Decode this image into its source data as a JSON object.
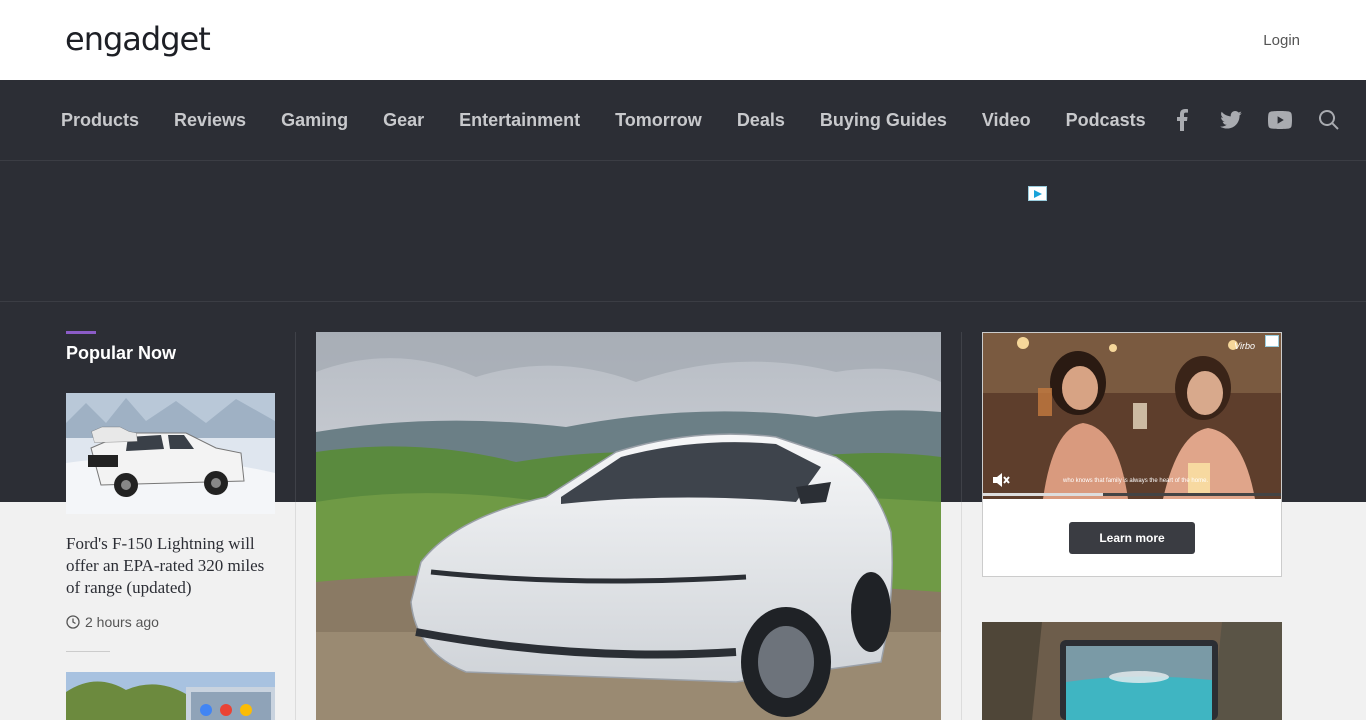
{
  "header": {
    "logo_text": "engadget",
    "login_label": "Login"
  },
  "nav": {
    "items": [
      "Products",
      "Reviews",
      "Gaming",
      "Gear",
      "Entertainment",
      "Tomorrow",
      "Deals",
      "Buying Guides",
      "Video",
      "Podcasts"
    ],
    "icons": [
      "facebook-icon",
      "twitter-icon",
      "youtube-icon",
      "search-icon"
    ]
  },
  "popular": {
    "title": "Popular Now",
    "items": [
      {
        "headline": "Ford's F-150 Lightning will offer an EPA-rated 320 miles of range (updated)",
        "time": "2 hours ago"
      }
    ]
  },
  "ad": {
    "learn_more": "Learn more",
    "caption": "who knows that family is always the heart of the home.",
    "brand": "Virbo"
  },
  "colors": {
    "nav_bg": "#2c2e35",
    "nav_text": "#c8c9cc",
    "accent": "#8b5cc7",
    "page_bg": "#f1f1f1"
  }
}
